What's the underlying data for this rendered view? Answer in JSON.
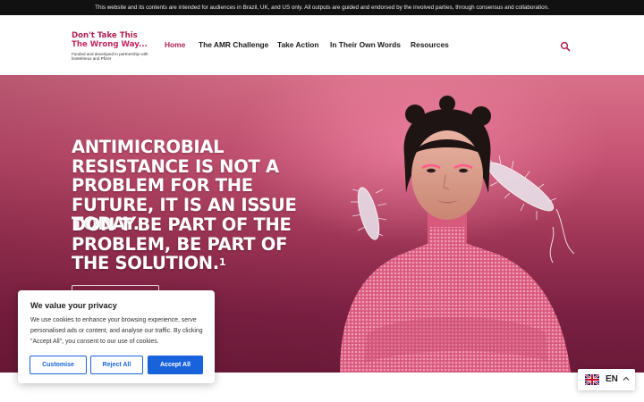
{
  "topbar": {
    "notice": "This website and its contents are intended for audiences in Brazil, UK, and US only. All outputs are guided and endorsed by the involved parties, through consensus and collaboration."
  },
  "header": {
    "logo": {
      "line1": "Don't Take This",
      "line2": "The Wrong Way...",
      "subtitle": "Funded and developed in partnership with bioMérieux and Pfizer"
    },
    "nav": [
      {
        "label": "Home",
        "active": true
      },
      {
        "label": "The AMR Challenge",
        "active": false
      },
      {
        "label": "Take Action",
        "active": false
      },
      {
        "label": "In Their Own Words",
        "active": false
      },
      {
        "label": "Resources",
        "active": false
      }
    ],
    "search_icon": "search-icon"
  },
  "hero": {
    "headline1": "Antimicrobial resistance is not a problem for the future, it is an issue today.",
    "headline2": "Don't be part of the problem, be part of the solution.",
    "footnote": "1"
  },
  "cookie": {
    "title": "We value your privacy",
    "text": "We use cookies to enhance your browsing experience, serve personalised ads or content, and analyse our traffic. By clicking \"Accept All\", you consent to our use of cookies.",
    "customise": "Customise",
    "reject": "Reject All",
    "accept": "Accept All"
  },
  "language": {
    "code": "EN",
    "flag_icon": "uk-flag-icon",
    "caret_icon": "chevron-up-icon"
  },
  "colors": {
    "brand": "#b0214f",
    "cookie_accent": "#1863dc",
    "topbar_bg": "#111111"
  }
}
